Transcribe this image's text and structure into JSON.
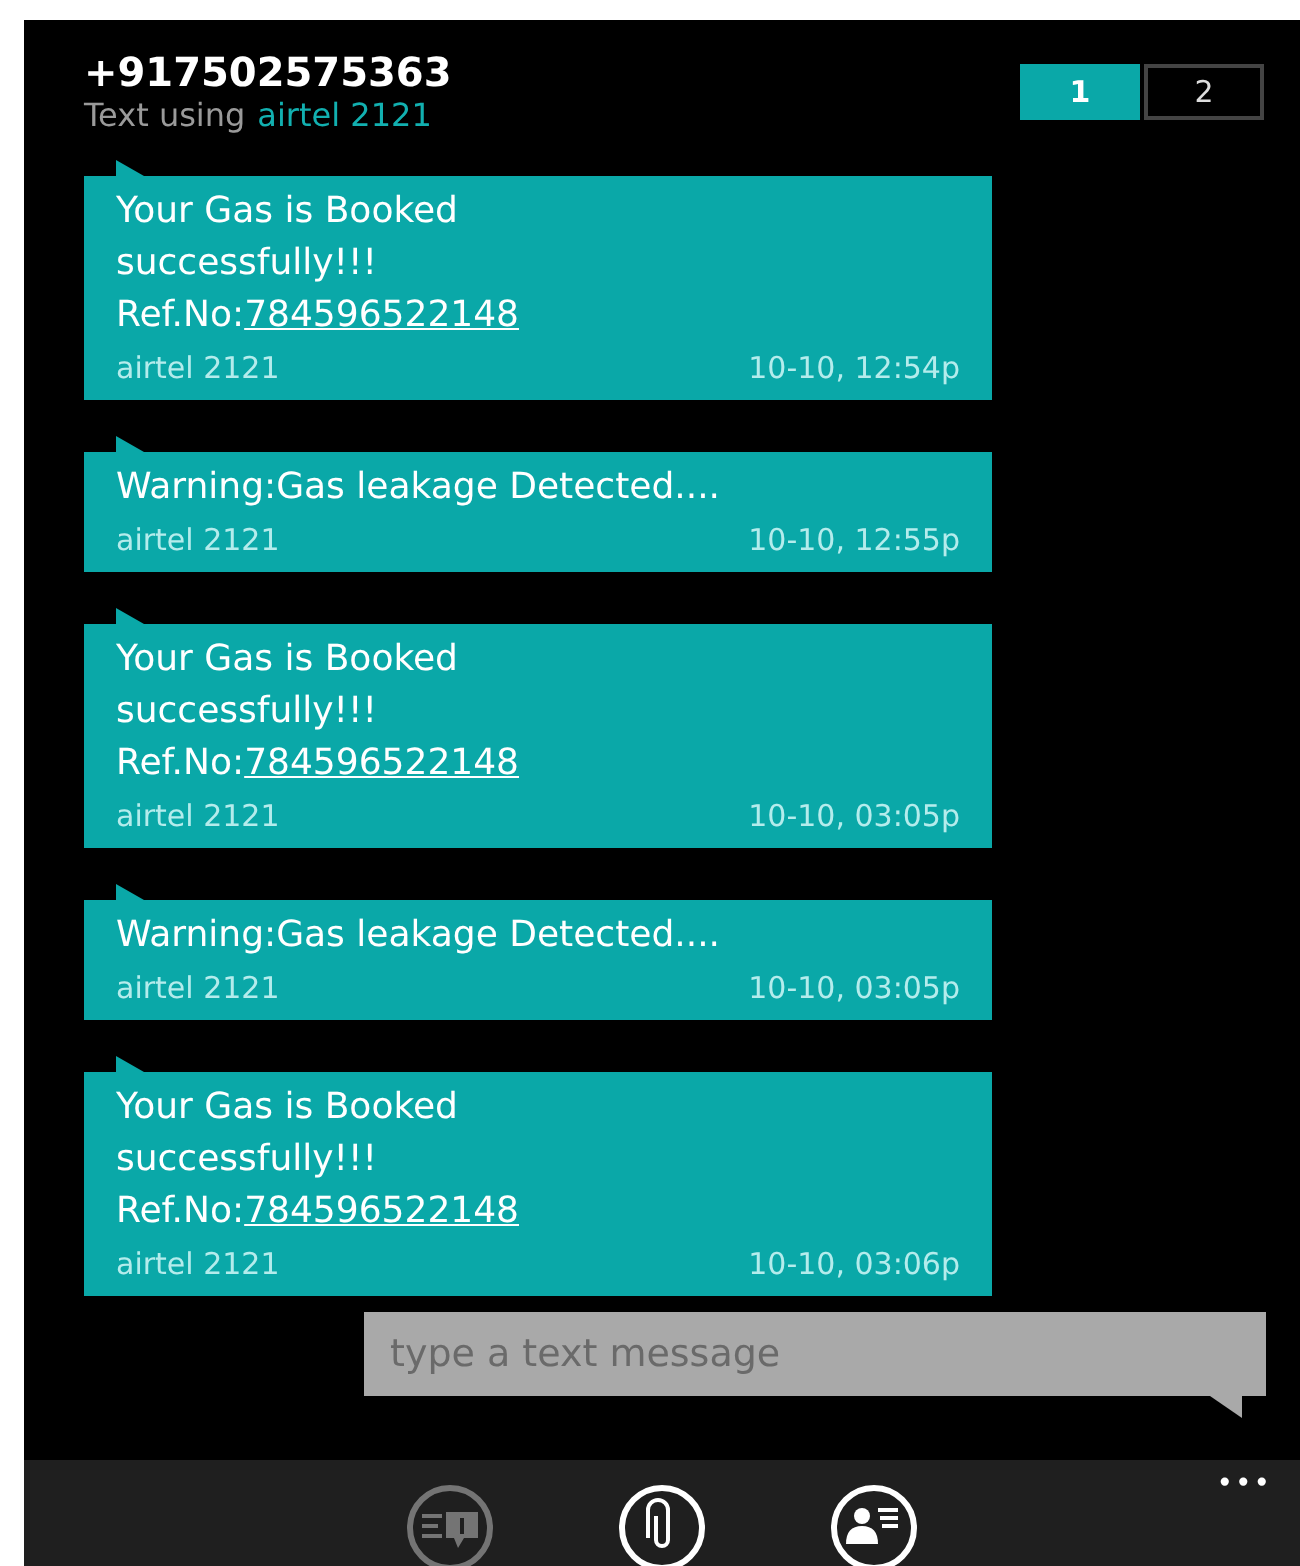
{
  "header": {
    "contact": "+917502575363",
    "subtitle_prefix": "Text using",
    "carrier": "airtel 2121"
  },
  "sim_tabs": [
    {
      "label": "1",
      "selected": true
    },
    {
      "label": "2",
      "selected": false
    }
  ],
  "messages": [
    {
      "lines": [
        "Your Gas is Booked",
        "successfully!!!"
      ],
      "ref_label": "Ref.No:",
      "ref_number": "784596522148",
      "sender": "airtel 2121",
      "time": "10-10, 12:54p"
    },
    {
      "lines": [
        "Warning:Gas leakage Detected...."
      ],
      "sender": "airtel 2121",
      "time": "10-10, 12:55p"
    },
    {
      "lines": [
        "Your Gas is Booked",
        "successfully!!!"
      ],
      "ref_label": "Ref.No:",
      "ref_number": "784596522148",
      "sender": "airtel 2121",
      "time": "10-10, 03:05p"
    },
    {
      "lines": [
        "Warning:Gas leakage Detected...."
      ],
      "sender": "airtel 2121",
      "time": "10-10, 03:05p"
    },
    {
      "lines": [
        "Your Gas is Booked",
        "successfully!!!"
      ],
      "ref_label": "Ref.No:",
      "ref_number": "784596522148",
      "sender": "airtel 2121",
      "time": "10-10, 03:06p"
    }
  ],
  "compose": {
    "placeholder": "type a text message"
  },
  "app_bar": {
    "buttons": [
      {
        "kind": "messages",
        "disabled": true
      },
      {
        "kind": "attach",
        "disabled": false
      },
      {
        "kind": "contact",
        "disabled": false
      }
    ],
    "more": "•••"
  }
}
